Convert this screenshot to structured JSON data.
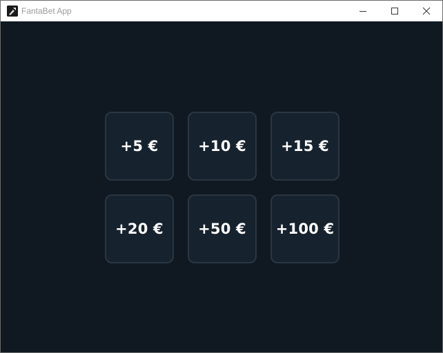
{
  "window": {
    "title": "FantaBet App",
    "icon": "app-logo-icon",
    "controls": {
      "minimize_icon": "minimize-icon",
      "maximize_icon": "maximize-icon",
      "close_icon": "close-icon"
    }
  },
  "colors": {
    "background": "#101922",
    "button_fill": "#16222e",
    "button_border": "#2a3642",
    "button_text": "#ffffff",
    "titlebar": "#ffffff",
    "title_text": "#9a9a9a"
  },
  "amounts": [
    {
      "label": "+5 €"
    },
    {
      "label": "+10 €"
    },
    {
      "label": "+15 €"
    },
    {
      "label": "+20 €"
    },
    {
      "label": "+50 €"
    },
    {
      "label": "+100 €"
    }
  ]
}
